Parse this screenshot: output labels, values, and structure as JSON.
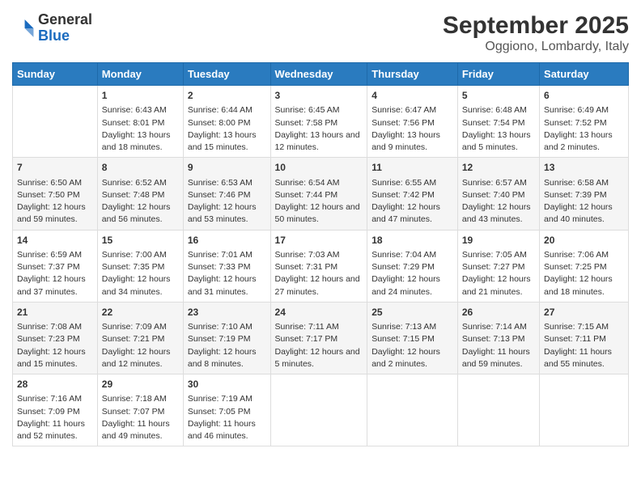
{
  "logo": {
    "line1": "General",
    "line2": "Blue"
  },
  "title": "September 2025",
  "subtitle": "Oggiono, Lombardy, Italy",
  "headers": [
    "Sunday",
    "Monday",
    "Tuesday",
    "Wednesday",
    "Thursday",
    "Friday",
    "Saturday"
  ],
  "weeks": [
    [
      {
        "day": "",
        "sunrise": "",
        "sunset": "",
        "daylight": ""
      },
      {
        "day": "1",
        "sunrise": "Sunrise: 6:43 AM",
        "sunset": "Sunset: 8:01 PM",
        "daylight": "Daylight: 13 hours and 18 minutes."
      },
      {
        "day": "2",
        "sunrise": "Sunrise: 6:44 AM",
        "sunset": "Sunset: 8:00 PM",
        "daylight": "Daylight: 13 hours and 15 minutes."
      },
      {
        "day": "3",
        "sunrise": "Sunrise: 6:45 AM",
        "sunset": "Sunset: 7:58 PM",
        "daylight": "Daylight: 13 hours and 12 minutes."
      },
      {
        "day": "4",
        "sunrise": "Sunrise: 6:47 AM",
        "sunset": "Sunset: 7:56 PM",
        "daylight": "Daylight: 13 hours and 9 minutes."
      },
      {
        "day": "5",
        "sunrise": "Sunrise: 6:48 AM",
        "sunset": "Sunset: 7:54 PM",
        "daylight": "Daylight: 13 hours and 5 minutes."
      },
      {
        "day": "6",
        "sunrise": "Sunrise: 6:49 AM",
        "sunset": "Sunset: 7:52 PM",
        "daylight": "Daylight: 13 hours and 2 minutes."
      }
    ],
    [
      {
        "day": "7",
        "sunrise": "Sunrise: 6:50 AM",
        "sunset": "Sunset: 7:50 PM",
        "daylight": "Daylight: 12 hours and 59 minutes."
      },
      {
        "day": "8",
        "sunrise": "Sunrise: 6:52 AM",
        "sunset": "Sunset: 7:48 PM",
        "daylight": "Daylight: 12 hours and 56 minutes."
      },
      {
        "day": "9",
        "sunrise": "Sunrise: 6:53 AM",
        "sunset": "Sunset: 7:46 PM",
        "daylight": "Daylight: 12 hours and 53 minutes."
      },
      {
        "day": "10",
        "sunrise": "Sunrise: 6:54 AM",
        "sunset": "Sunset: 7:44 PM",
        "daylight": "Daylight: 12 hours and 50 minutes."
      },
      {
        "day": "11",
        "sunrise": "Sunrise: 6:55 AM",
        "sunset": "Sunset: 7:42 PM",
        "daylight": "Daylight: 12 hours and 47 minutes."
      },
      {
        "day": "12",
        "sunrise": "Sunrise: 6:57 AM",
        "sunset": "Sunset: 7:40 PM",
        "daylight": "Daylight: 12 hours and 43 minutes."
      },
      {
        "day": "13",
        "sunrise": "Sunrise: 6:58 AM",
        "sunset": "Sunset: 7:39 PM",
        "daylight": "Daylight: 12 hours and 40 minutes."
      }
    ],
    [
      {
        "day": "14",
        "sunrise": "Sunrise: 6:59 AM",
        "sunset": "Sunset: 7:37 PM",
        "daylight": "Daylight: 12 hours and 37 minutes."
      },
      {
        "day": "15",
        "sunrise": "Sunrise: 7:00 AM",
        "sunset": "Sunset: 7:35 PM",
        "daylight": "Daylight: 12 hours and 34 minutes."
      },
      {
        "day": "16",
        "sunrise": "Sunrise: 7:01 AM",
        "sunset": "Sunset: 7:33 PM",
        "daylight": "Daylight: 12 hours and 31 minutes."
      },
      {
        "day": "17",
        "sunrise": "Sunrise: 7:03 AM",
        "sunset": "Sunset: 7:31 PM",
        "daylight": "Daylight: 12 hours and 27 minutes."
      },
      {
        "day": "18",
        "sunrise": "Sunrise: 7:04 AM",
        "sunset": "Sunset: 7:29 PM",
        "daylight": "Daylight: 12 hours and 24 minutes."
      },
      {
        "day": "19",
        "sunrise": "Sunrise: 7:05 AM",
        "sunset": "Sunset: 7:27 PM",
        "daylight": "Daylight: 12 hours and 21 minutes."
      },
      {
        "day": "20",
        "sunrise": "Sunrise: 7:06 AM",
        "sunset": "Sunset: 7:25 PM",
        "daylight": "Daylight: 12 hours and 18 minutes."
      }
    ],
    [
      {
        "day": "21",
        "sunrise": "Sunrise: 7:08 AM",
        "sunset": "Sunset: 7:23 PM",
        "daylight": "Daylight: 12 hours and 15 minutes."
      },
      {
        "day": "22",
        "sunrise": "Sunrise: 7:09 AM",
        "sunset": "Sunset: 7:21 PM",
        "daylight": "Daylight: 12 hours and 12 minutes."
      },
      {
        "day": "23",
        "sunrise": "Sunrise: 7:10 AM",
        "sunset": "Sunset: 7:19 PM",
        "daylight": "Daylight: 12 hours and 8 minutes."
      },
      {
        "day": "24",
        "sunrise": "Sunrise: 7:11 AM",
        "sunset": "Sunset: 7:17 PM",
        "daylight": "Daylight: 12 hours and 5 minutes."
      },
      {
        "day": "25",
        "sunrise": "Sunrise: 7:13 AM",
        "sunset": "Sunset: 7:15 PM",
        "daylight": "Daylight: 12 hours and 2 minutes."
      },
      {
        "day": "26",
        "sunrise": "Sunrise: 7:14 AM",
        "sunset": "Sunset: 7:13 PM",
        "daylight": "Daylight: 11 hours and 59 minutes."
      },
      {
        "day": "27",
        "sunrise": "Sunrise: 7:15 AM",
        "sunset": "Sunset: 7:11 PM",
        "daylight": "Daylight: 11 hours and 55 minutes."
      }
    ],
    [
      {
        "day": "28",
        "sunrise": "Sunrise: 7:16 AM",
        "sunset": "Sunset: 7:09 PM",
        "daylight": "Daylight: 11 hours and 52 minutes."
      },
      {
        "day": "29",
        "sunrise": "Sunrise: 7:18 AM",
        "sunset": "Sunset: 7:07 PM",
        "daylight": "Daylight: 11 hours and 49 minutes."
      },
      {
        "day": "30",
        "sunrise": "Sunrise: 7:19 AM",
        "sunset": "Sunset: 7:05 PM",
        "daylight": "Daylight: 11 hours and 46 minutes."
      },
      {
        "day": "",
        "sunrise": "",
        "sunset": "",
        "daylight": ""
      },
      {
        "day": "",
        "sunrise": "",
        "sunset": "",
        "daylight": ""
      },
      {
        "day": "",
        "sunrise": "",
        "sunset": "",
        "daylight": ""
      },
      {
        "day": "",
        "sunrise": "",
        "sunset": "",
        "daylight": ""
      }
    ]
  ]
}
